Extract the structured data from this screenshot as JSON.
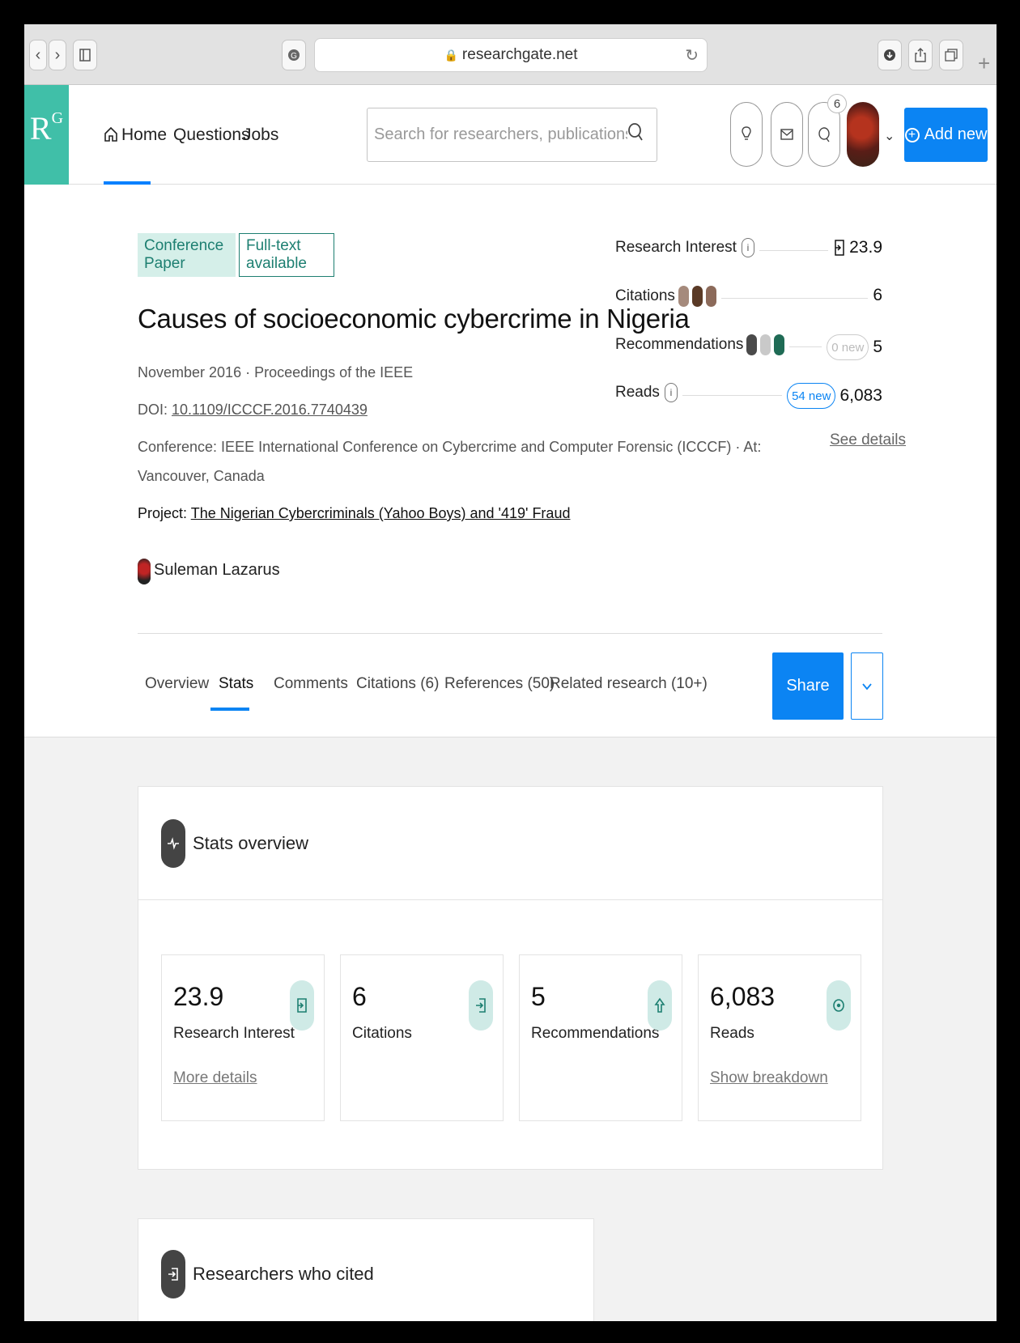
{
  "browser": {
    "url": "researchgate.net",
    "back_icon": "‹",
    "forward_icon": "›",
    "new_tab": "+"
  },
  "header": {
    "logo": "R",
    "logo_sup": "G",
    "nav": [
      "Home",
      "Questions",
      "Jobs"
    ],
    "search_placeholder": "Search for researchers, publications, and more",
    "notification_count": "6",
    "add_new_label": "Add new"
  },
  "publication": {
    "type_tag": "Conference Paper",
    "fulltext_tag": "Full-text available",
    "title": "Causes of socioeconomic cybercrime in Nigeria",
    "date_journal": "November 2016 · Proceedings of the IEEE",
    "doi_prefix": "DOI: ",
    "doi": "10.1109/ICCCF.2016.7740439",
    "conference_line1": "Conference: IEEE International Conference on Cybercrime and Computer Forensic (ICCCF) · At:",
    "conference_line2": "Vancouver, Canada",
    "project_prefix": "Project: ",
    "project": "The Nigerian Cybercriminals (Yahoo Boys) and '419' Fraud",
    "author": "Suleman Lazarus"
  },
  "side_stats": {
    "research_interest_label": "Research Interest",
    "research_interest_value": "23.9",
    "citations_label": "Citations",
    "citations_value": "6",
    "recommendations_label": "Recommendations",
    "recommendations_new": "0 new",
    "recommendations_value": "5",
    "reads_label": "Reads",
    "reads_new": "54 new",
    "reads_value": "6,083",
    "see_details": "See details"
  },
  "tabs": [
    "Overview",
    "Stats",
    "Comments",
    "Citations (6)",
    "References (50)",
    "Related research (10+)"
  ],
  "share_label": "Share",
  "stats_overview": {
    "title": "Stats overview",
    "metrics": [
      {
        "value": "23.9",
        "label": "Research Interest",
        "link": "More details"
      },
      {
        "value": "6",
        "label": "Citations",
        "link": ""
      },
      {
        "value": "5",
        "label": "Recommendations",
        "link": ""
      },
      {
        "value": "6,083",
        "label": "Reads",
        "link": "Show breakdown"
      }
    ]
  },
  "cited": {
    "title": "Researchers who cited"
  },
  "colors": {
    "brand": "#40bfa8",
    "accent": "#0b84f3",
    "teal_text": "#1d7f71"
  }
}
